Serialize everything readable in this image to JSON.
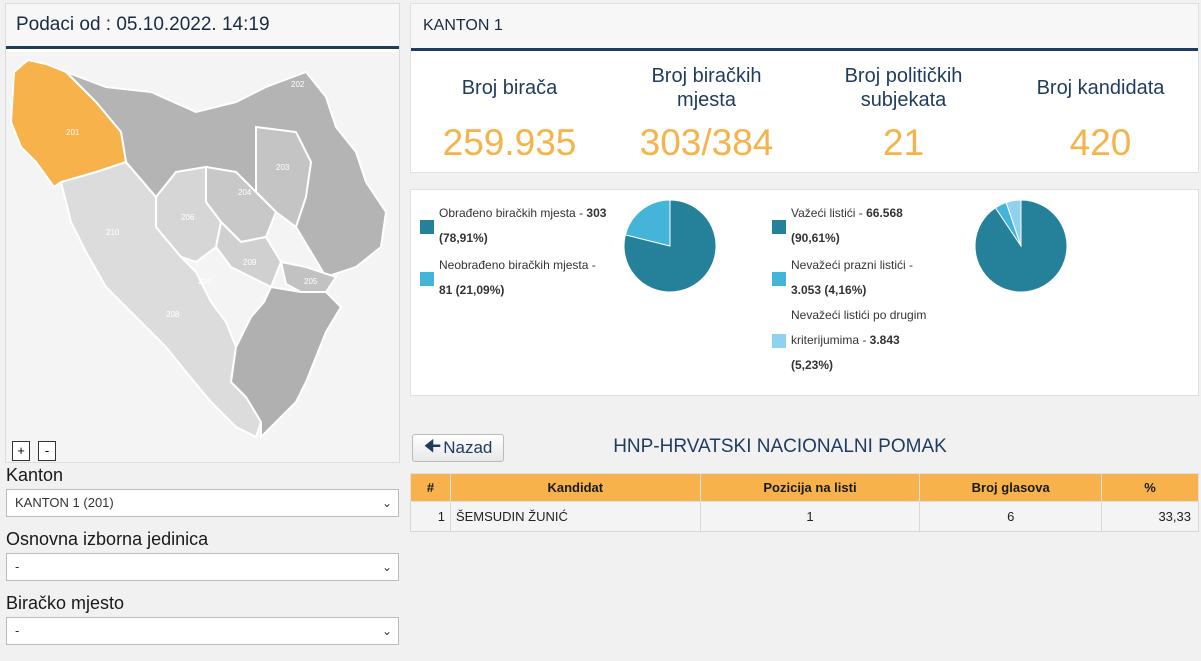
{
  "left": {
    "header": "Podaci od : 05.10.2022. 14:19",
    "zoom_in": "+",
    "zoom_out": "-",
    "map_labels": [
      "201",
      "202",
      "203",
      "204",
      "205",
      "206",
      "207",
      "208",
      "209",
      "210"
    ]
  },
  "filters": {
    "kanton_label": "Kanton",
    "kanton_value": "KANTON 1 (201)",
    "oij_label": "Osnovna izborna jedinica",
    "oij_value": "-",
    "bm_label": "Biračko mjesto",
    "bm_value": "-"
  },
  "stats": {
    "title": "KANTON 1",
    "items": [
      {
        "label": "Broj birača",
        "value": "259.935"
      },
      {
        "label": "Broj biračkih mjesta",
        "value": "303/384"
      },
      {
        "label": "Broj političkih subjekata",
        "value": "21"
      },
      {
        "label": "Broj kandidata",
        "value": "420"
      }
    ]
  },
  "charts": {
    "stations": {
      "items": [
        {
          "label": "Obrađeno biračkih mjesta - ",
          "value": "303 (78,91%)",
          "color": "#25809a",
          "fraction": 0.7891
        },
        {
          "label": "Neobrađeno biračkih mjesta - ",
          "value": "81 (21,09%)",
          "color": "#44b4d8",
          "fraction": 0.2109
        }
      ]
    },
    "ballots": {
      "items": [
        {
          "label": "Važeći listići - ",
          "value": "66.568 (90,61%)",
          "color": "#25809a",
          "fraction": 0.9061
        },
        {
          "label": "Nevažeći prazni listići - ",
          "value": "3.053 (4,16%)",
          "color": "#44b4d8",
          "fraction": 0.0416
        },
        {
          "label": "Nevažeći listići po drugim kriterijumima - ",
          "value": "3.843 (5,23%)",
          "color": "#8fd1ee",
          "fraction": 0.0523
        }
      ]
    }
  },
  "nav": {
    "back_label": "Nazad",
    "party_title": "HNP-HRVATSKI NACIONALNI POMAK"
  },
  "table": {
    "headers": [
      "#",
      "Kandidat",
      "Pozicija na listi",
      "Broj glasova",
      "%"
    ],
    "rows": [
      [
        "1",
        "ŠEMSUDIN ŽUNIĆ",
        "1",
        "6",
        "33,33"
      ]
    ]
  },
  "colors": {
    "accent_orange": "#f5b34a",
    "navy": "#1f3b5e",
    "map_selected": "#f7b24b"
  }
}
